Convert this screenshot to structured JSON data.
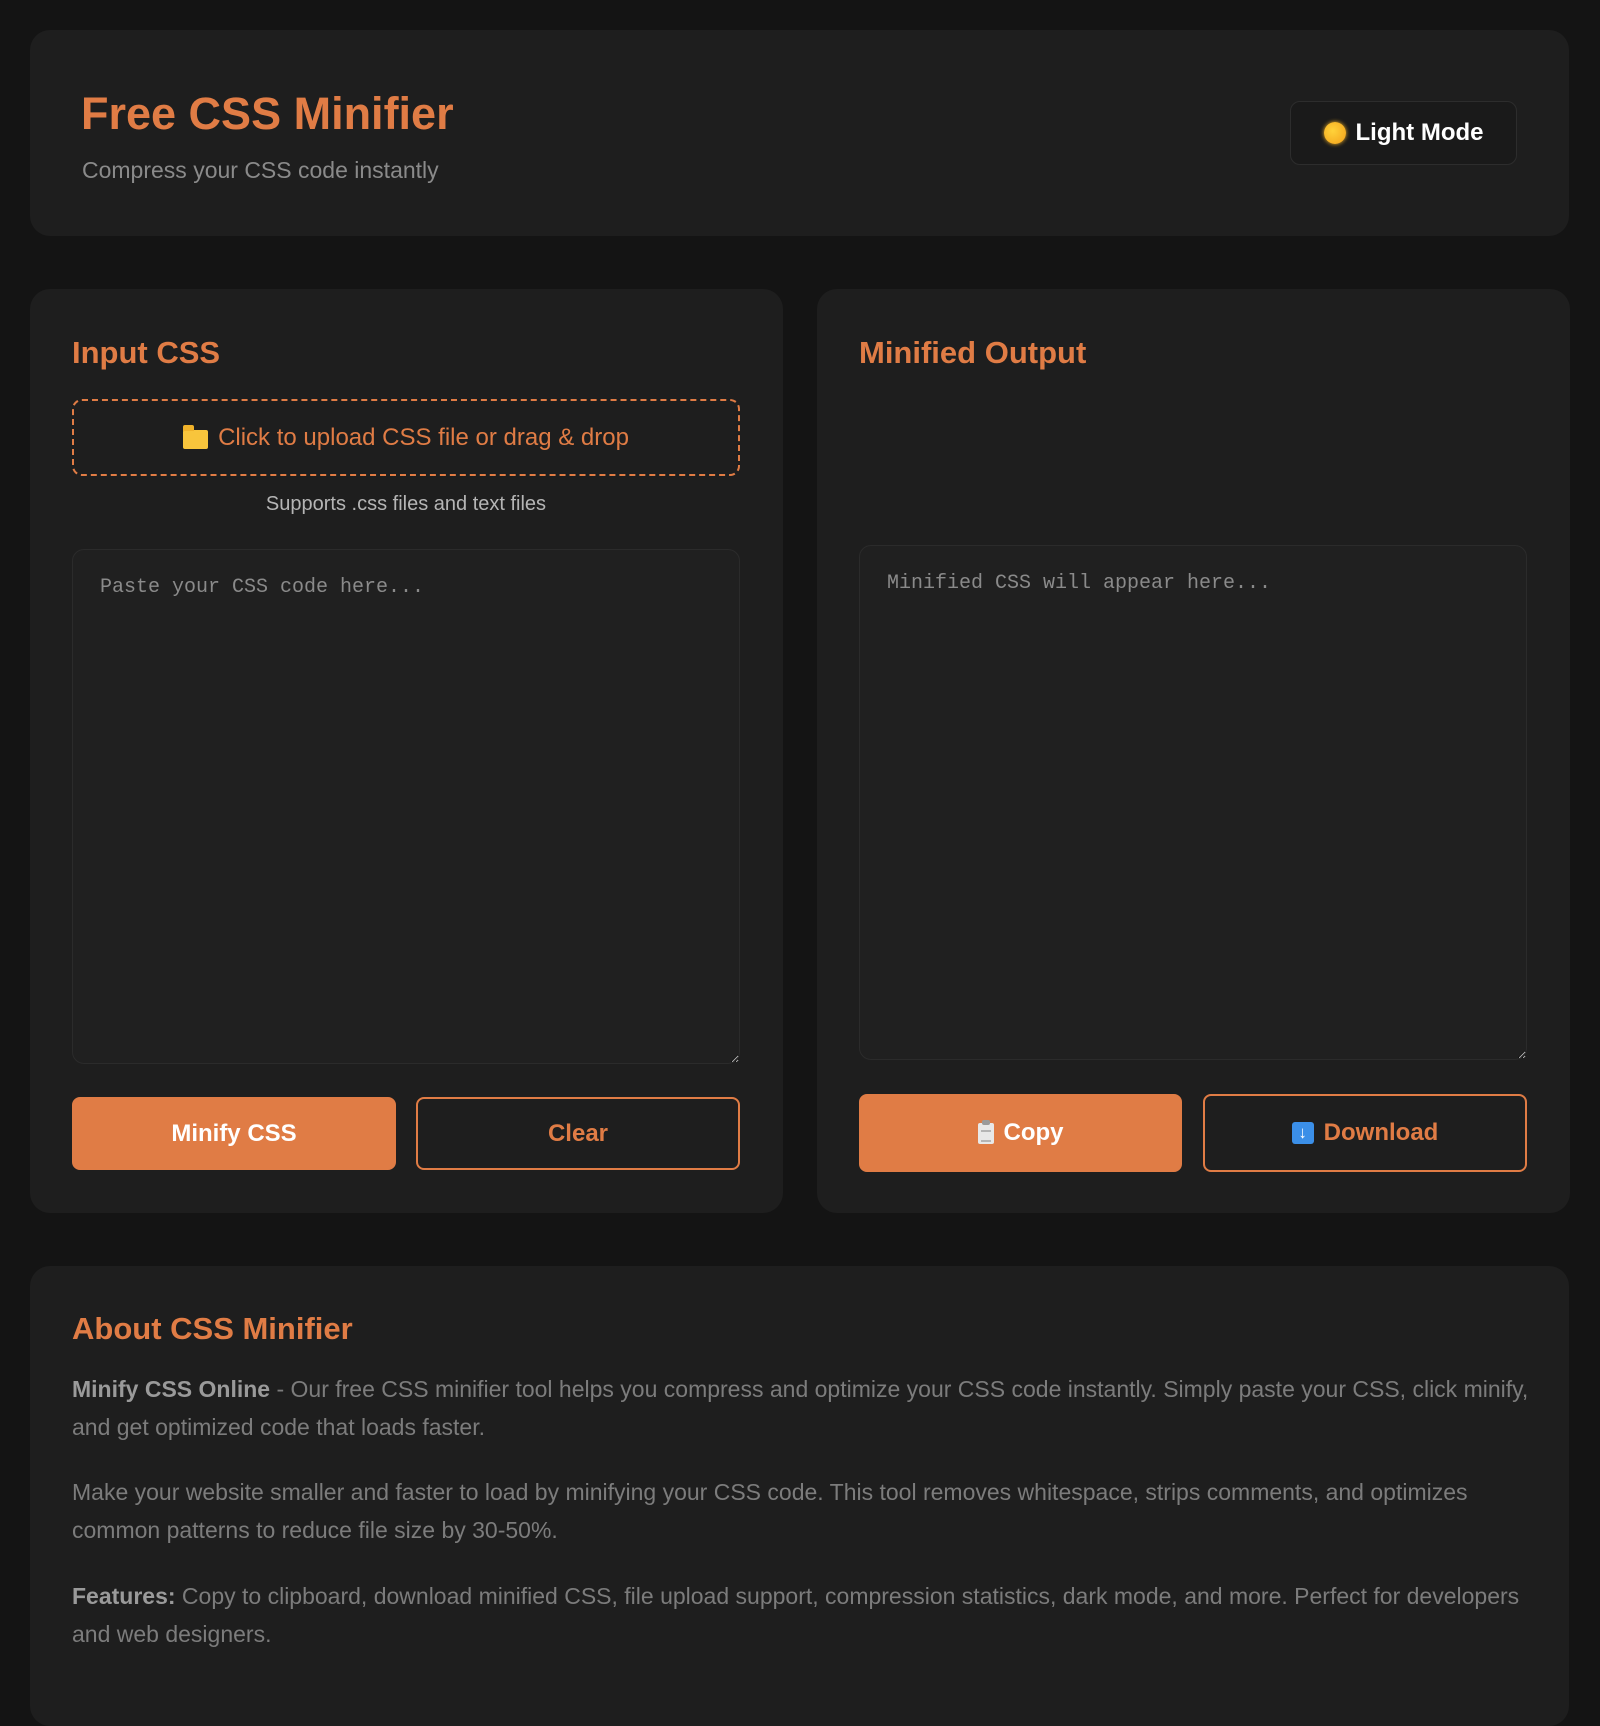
{
  "header": {
    "title": "Free CSS Minifier",
    "subtitle": "Compress your CSS code instantly",
    "theme_toggle": {
      "icon": "sun-icon",
      "label": "Light Mode"
    }
  },
  "input_panel": {
    "title": "Input CSS",
    "upload": {
      "icon": "folder-icon",
      "label": "Click to upload CSS file or drag & drop"
    },
    "upload_hint": "Supports .css files and text files",
    "textarea_placeholder": "Paste your CSS code here...",
    "minify_label": "Minify CSS",
    "clear_label": "Clear"
  },
  "output_panel": {
    "title": "Minified Output",
    "textarea_placeholder": "Minified CSS will appear here...",
    "copy": {
      "icon": "clipboard-icon",
      "label": "Copy"
    },
    "download": {
      "icon": "download-arrow-icon",
      "label": "Download"
    }
  },
  "about": {
    "title": "About CSS Minifier",
    "p1_bold": "Minify CSS Online",
    "p1_text": " - Our free CSS minifier tool helps you compress and optimize your CSS code instantly. Simply paste your CSS, click minify, and get optimized code that loads faster.",
    "p2_text": "Make your website smaller and faster to load by minifying your CSS code. This tool removes whitespace, strips comments, and optimizes common patterns to reduce file size by 30-50%.",
    "p3_bold": "Features:",
    "p3_text": " Copy to clipboard, download minified CSS, file upload support, compression statistics, dark mode, and more. Perfect for developers and web designers."
  },
  "colors": {
    "accent": "#e07c45",
    "background": "#141414",
    "card": "#1e1e1e"
  }
}
